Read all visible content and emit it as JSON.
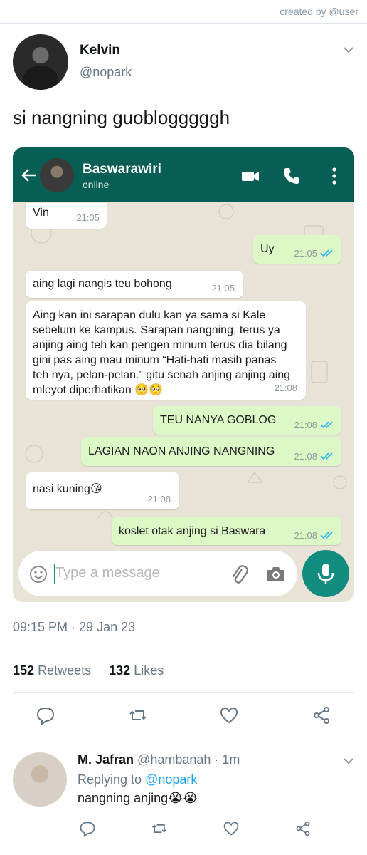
{
  "credit": "created by @user",
  "tweet": {
    "author_name": "Kelvin",
    "author_handle": "@nopark",
    "text": "si nangning guoblogggggh",
    "timestamp": "09:15 PM · 29 Jan 23",
    "retweets_count": "152",
    "retweets_label": "Retweets",
    "likes_count": "132",
    "likes_label": "Likes"
  },
  "whatsapp": {
    "contact_name": "Baswarawiri",
    "contact_status": "online",
    "input_placeholder": "Type a message",
    "messages": [
      {
        "dir": "in",
        "text": "Vin",
        "time": "21:05"
      },
      {
        "dir": "out",
        "text": "Uy",
        "time": "21:05"
      },
      {
        "dir": "in",
        "text": "aing lagi nangis teu bohong",
        "time": "21:05"
      },
      {
        "dir": "in",
        "lines": [
          "Aing kan ini sarapan dulu kan ya sama si Kale",
          "sebelum ke kampus. Sarapan nangning, terus ya",
          "anjing aing teh kan pengen minum terus dia bilang",
          "gini pas aing mau minum “Hati-hati masih panas",
          "teh nya, pelan-pelan.” gitu senah anjing anjing aing",
          "mleyot diperhatikan 🥺🥺"
        ],
        "time": "21:08"
      },
      {
        "dir": "out",
        "text": "TEU NANYA GOBLOG",
        "time": "21:08"
      },
      {
        "dir": "out",
        "text": "LAGIAN NAON ANJING NANGNING",
        "time": "21:08"
      },
      {
        "dir": "in",
        "text": "nasi kuning😘",
        "time": "21:08"
      },
      {
        "dir": "out",
        "text": "koslet otak anjing si Baswara",
        "time": "21:08"
      }
    ],
    "colors": {
      "header": "#075e54",
      "outgoing": "#dcf8c6",
      "incoming": "#ffffff",
      "ticks": "#34b7f1",
      "mic": "#128c7e"
    }
  },
  "reply": {
    "name": "M. Jafran",
    "handle": "@hambanah",
    "age": "· 1m",
    "replying_prefix": "Replying to",
    "replying_to": "@nopark",
    "text": "nangning anjing😭😭"
  }
}
